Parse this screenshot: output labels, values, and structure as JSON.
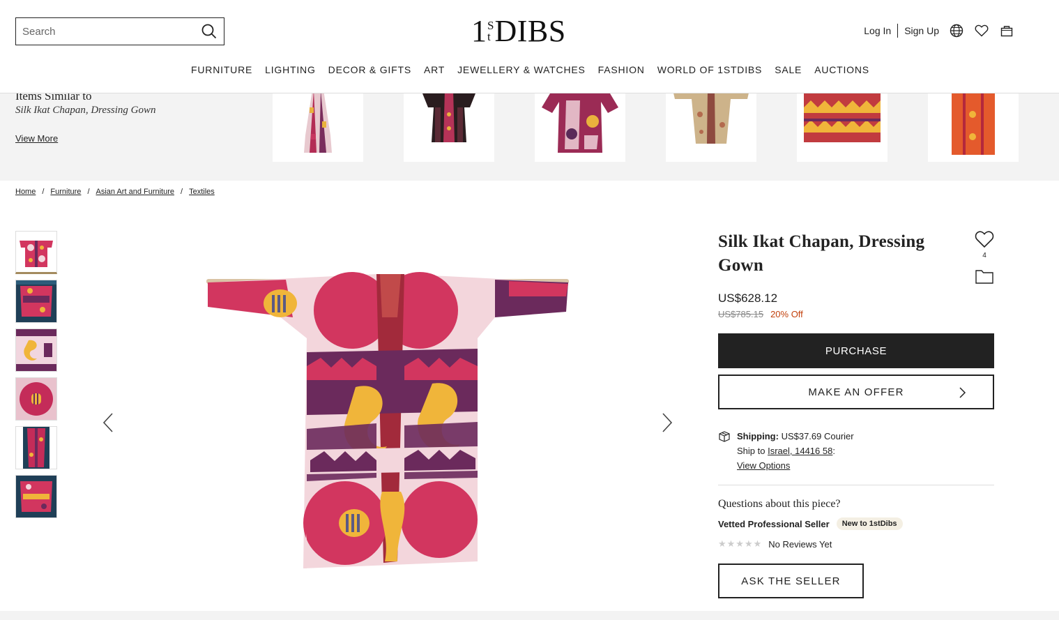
{
  "header": {
    "search_placeholder": "Search",
    "logo": {
      "one": "1",
      "s": "S",
      "t": "t",
      "dibs": "DIBS"
    },
    "login": "Log In",
    "signup": "Sign Up",
    "icons": [
      "search-icon",
      "globe-icon",
      "heart-icon",
      "bag-icon"
    ]
  },
  "nav": [
    "FURNITURE",
    "LIGHTING",
    "DECOR & GIFTS",
    "ART",
    "JEWELLERY & WATCHES",
    "FASHION",
    "WORLD OF 1STDIBS",
    "SALE",
    "AUCTIONS"
  ],
  "similar": {
    "title": "Items Similar to",
    "subtitle": "Silk Ikat Chapan, Dressing Gown",
    "view_more": "View More"
  },
  "breadcrumb": [
    "Home",
    "Furniture",
    "Asian Art and Furniture",
    "Textiles"
  ],
  "product": {
    "title": "Silk Ikat Chapan, Dressing Gown",
    "favorite_count": "4",
    "price": "US$628.12",
    "original_price": "US$785.15",
    "discount": "20% Off",
    "purchase_label": "PURCHASE",
    "offer_label": "MAKE AN OFFER",
    "shipping_label": "Shipping:",
    "shipping_value": "US$37.69 Courier",
    "ship_to_prefix": "Ship to",
    "ship_to_location": "Israel, 14416 58",
    "ship_to_suffix": ":",
    "view_options": "View Options",
    "questions": "Questions about this piece?",
    "seller_type": "Vetted Professional Seller",
    "seller_badge": "New to 1stDibs",
    "reviews_stars": "★★★★★",
    "reviews_text": "No Reviews Yet",
    "ask_label": "ASK THE SELLER"
  },
  "colors": {
    "accent_dark": "#222222",
    "thumb_active": "#a48b5e",
    "discount": "#c2410c",
    "ikat_pink": "#d2365f",
    "ikat_purple": "#6b2a5c",
    "ikat_yellow": "#f0b53a"
  }
}
